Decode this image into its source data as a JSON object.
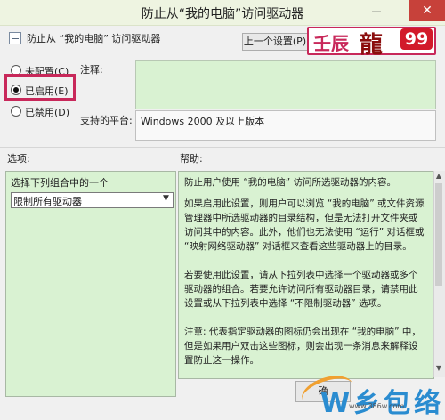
{
  "window": {
    "title": "防止从“我的电脑”访问驱动器",
    "minimize_glyph": "—",
    "close_glyph": "✕"
  },
  "header": {
    "policy_name": "防止从 “我的电脑” 访问驱动器",
    "prev_button": "上一个设置(P)"
  },
  "state_options": [
    {
      "label": "未配置(C)",
      "checked": false
    },
    {
      "label": "已启用(E)",
      "checked": true
    },
    {
      "label": "已禁用(D)",
      "checked": false
    }
  ],
  "labels": {
    "comment": "注释:",
    "platform": "支持的平台:",
    "options": "选项:",
    "help": "帮助:"
  },
  "platform_value": "Windows 2000 及以上版本",
  "options_panel": {
    "title": "选择下列组合中的一个",
    "dropdown_value": "限制所有驱动器"
  },
  "help_paragraphs": [
    "防止用户使用 “我的电脑” 访问所选驱动器的内容。",
    "如果启用此设置，则用户可以浏览 “我的电脑” 或文件资源管理器中所选驱动器的目录结构，但是无法打开文件夹或访问其中的内容。此外，他们也无法使用 “运行” 对话框或 “映射网络驱动器” 对话框来查看这些驱动器上的目录。",
    "若要使用此设置，请从下拉列表中选择一个驱动器或多个驱动器的组合。若要允许访问所有驱动器目录，请禁用此设置或从下拉列表中选择 “不限制驱动器” 选项。",
    "注意: 代表指定驱动器的图标仍会出现在 “我的电脑” 中，但是如果用户双击这些图标，则会出现一条消息来解释设置防止这一操作。"
  ],
  "buttons": {
    "ok": "确"
  },
  "watermark_logo": {
    "left": "壬辰",
    "right": "99"
  },
  "watermark_site": {
    "text": "W乡包络",
    "url": "www.386w.com"
  },
  "colors": {
    "green_panel": "#d9f2d2",
    "highlight": "#c8285a",
    "close_red": "#c7413a"
  }
}
